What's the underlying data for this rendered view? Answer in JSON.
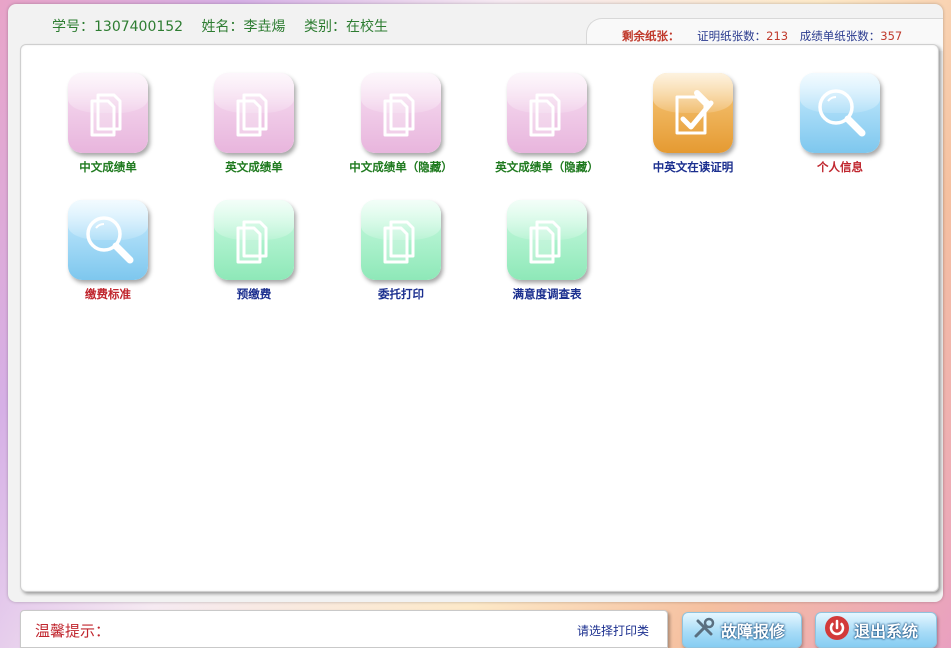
{
  "header": {
    "student_id": "学号：1307400152",
    "name": "姓名：李垚煬",
    "category": "类别：在校生"
  },
  "paper": {
    "remain_label": "剩余纸张：",
    "cert_label": "证明纸张数：",
    "cert_count": "213",
    "transcript_label": "成绩单纸张数：",
    "transcript_count": "357"
  },
  "tiles": [
    {
      "label": "中文成绩单",
      "icon": "document-icon",
      "color": "pink"
    },
    {
      "label": "英文成绩单",
      "icon": "document-icon",
      "color": "pink"
    },
    {
      "label": "中文成绩单（隐藏）",
      "icon": "document-icon",
      "color": "pink"
    },
    {
      "label": "英文成绩单（隐藏）",
      "icon": "document-icon",
      "color": "pink"
    },
    {
      "label": "中英文在读证明",
      "icon": "certificate-icon",
      "color": "orange"
    },
    {
      "label": "个人信息",
      "icon": "magnifier-icon",
      "color": "blue"
    },
    {
      "label": "缴费标准",
      "icon": "magnifier-icon",
      "color": "blue"
    },
    {
      "label": "预缴费",
      "icon": "document-icon",
      "color": "green"
    },
    {
      "label": "委托打印",
      "icon": "document-icon",
      "color": "green"
    },
    {
      "label": "满意度调查表",
      "icon": "document-icon",
      "color": "green"
    }
  ],
  "footer": {
    "tip_label": "温馨提示：",
    "tip_message": "请选择打印类",
    "repair_label": "故障报修",
    "exit_label": "退出系统"
  },
  "colors": {
    "green_text": "#1f7a1f",
    "navy_text": "#1b2f8f",
    "red_text": "#c0262e"
  }
}
